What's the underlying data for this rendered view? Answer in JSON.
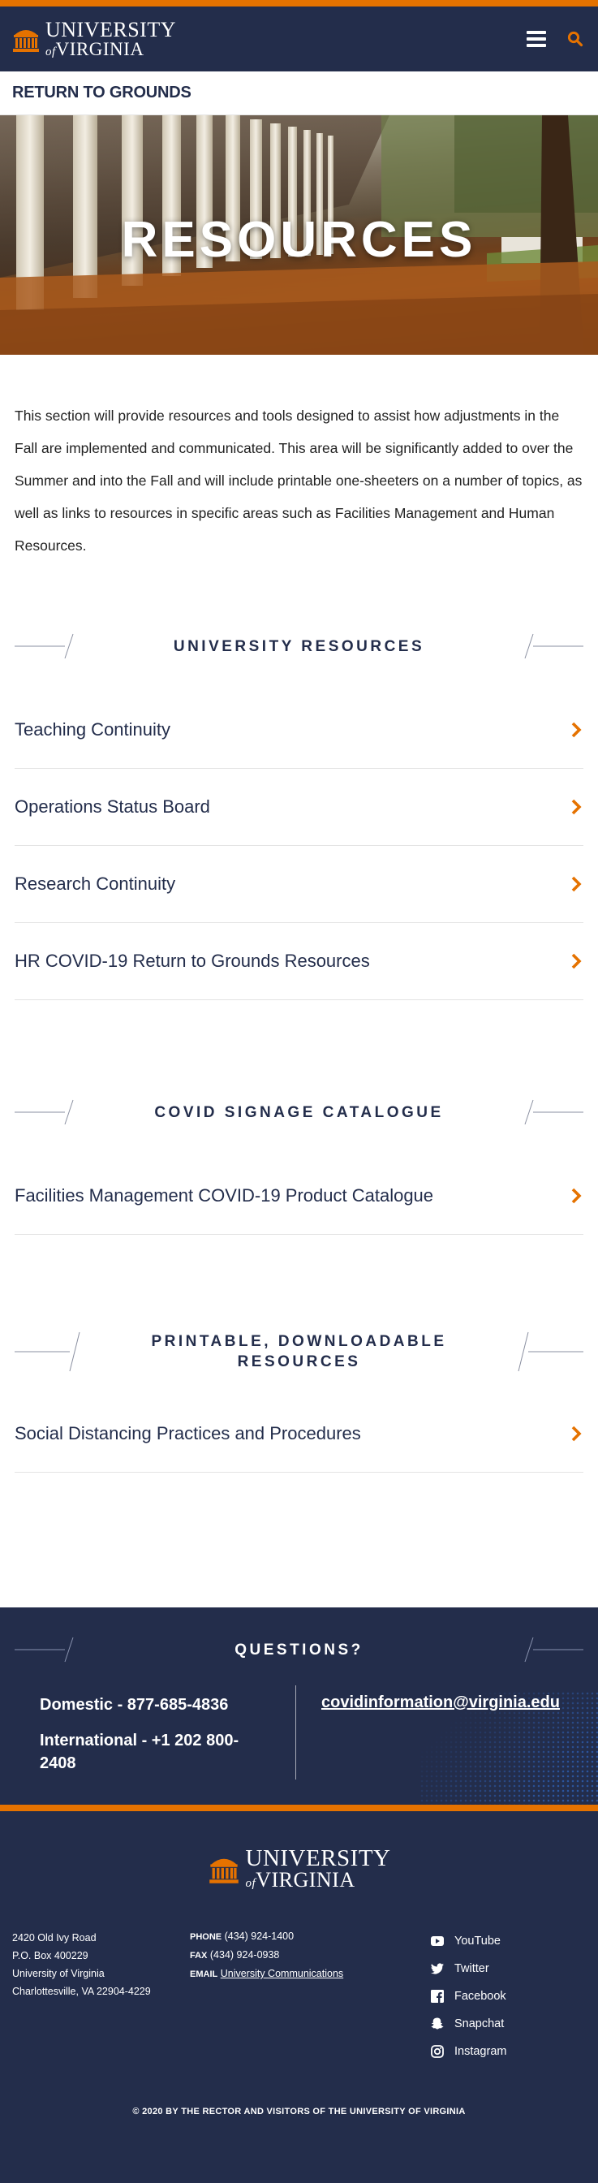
{
  "header": {
    "logo_line1": "UNIVERSITY",
    "logo_of": "of",
    "logo_line2": "VIRGINIA",
    "menu_icon": "hamburger-icon",
    "search_icon": "search-icon"
  },
  "subnav": {
    "label": "RETURN TO GROUNDS"
  },
  "hero": {
    "title": "RESOURCES"
  },
  "intro": {
    "text": "This section will provide resources and tools designed to assist how adjustments in the Fall are implemented and communicated. This area will be significantly added to over the Summer and into the Fall and will include printable one-sheeters on a number of topics, as well as links to resources in specific areas such as Facilities Management and Human Resources."
  },
  "sections": [
    {
      "heading": "UNIVERSITY RESOURCES",
      "links": [
        "Teaching Continuity",
        "Operations Status Board",
        "Research Continuity",
        "HR COVID-19 Return to Grounds Resources"
      ]
    },
    {
      "heading": "COVID SIGNAGE CATALOGUE",
      "links": [
        "Facilities Management COVID-19 Product Catalogue"
      ]
    },
    {
      "heading": "PRINTABLE, DOWNLOADABLE RESOURCES",
      "links": [
        "Social Distancing Practices and Procedures"
      ]
    }
  ],
  "questions": {
    "heading": "QUESTIONS?",
    "domestic": "Domestic - 877-685-4836",
    "international": "International - +1 202 800-2408",
    "email": "covidinformation@virginia.edu"
  },
  "footer": {
    "address": [
      "2420 Old Ivy Road",
      "P.O. Box 400229",
      "University of Virginia",
      "Charlottesville, VA 22904-4229"
    ],
    "phone_label": "PHONE",
    "phone": "(434) 924-1400",
    "fax_label": "FAX",
    "fax": "(434) 924-0938",
    "email_label": "EMAIL",
    "email_link": "University Communications",
    "social": [
      {
        "label": "YouTube",
        "icon": "youtube-icon"
      },
      {
        "label": "Twitter",
        "icon": "twitter-icon"
      },
      {
        "label": "Facebook",
        "icon": "facebook-icon"
      },
      {
        "label": "Snapchat",
        "icon": "snapchat-icon"
      },
      {
        "label": "Instagram",
        "icon": "instagram-icon"
      }
    ],
    "copyright": "© 2020 BY THE RECTOR AND VISITORS OF THE UNIVERSITY OF VIRGINIA"
  },
  "colors": {
    "navy": "#232d4b",
    "orange": "#e57200",
    "white": "#ffffff"
  }
}
